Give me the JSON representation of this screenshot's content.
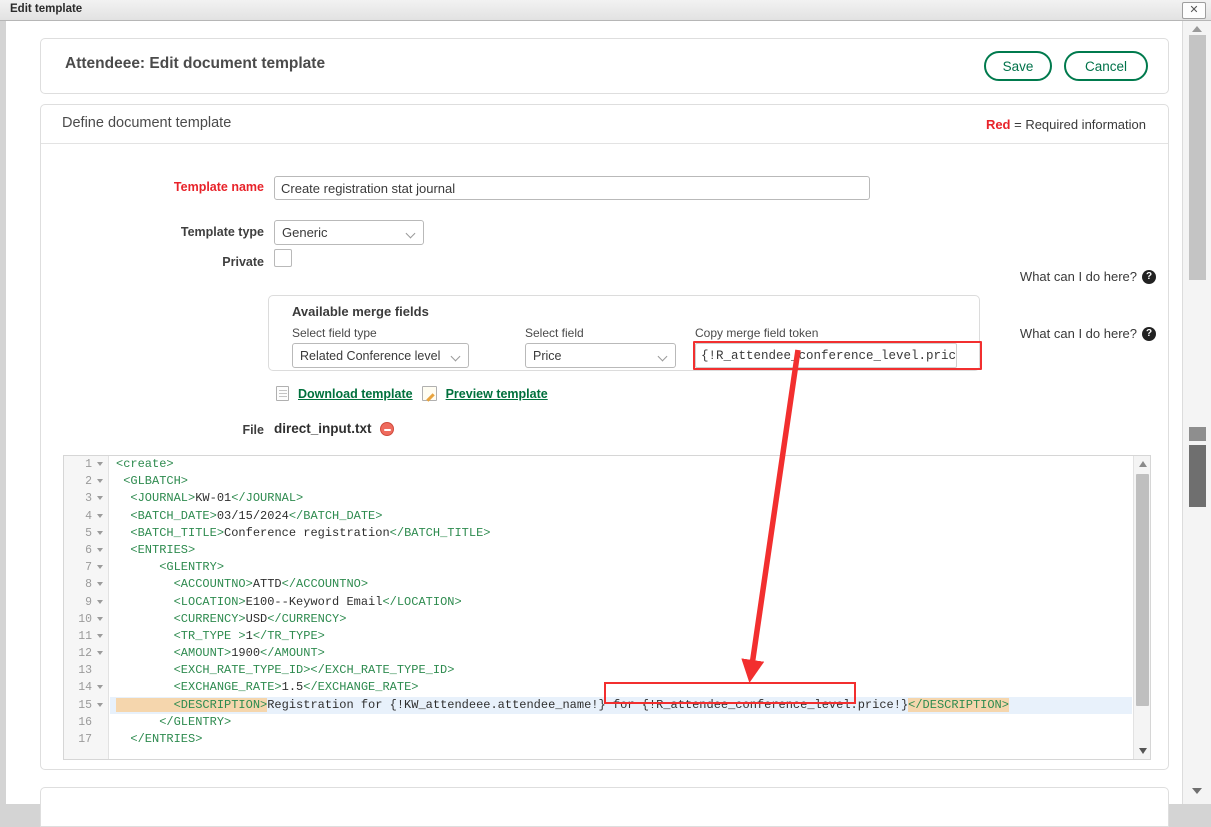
{
  "window": {
    "title": "Edit template",
    "close_label": "✕"
  },
  "header": {
    "page_title": "Attendeee: Edit document template",
    "save_label": "Save",
    "cancel_label": "Cancel"
  },
  "section": {
    "title": "Define document template",
    "required_red": "Red",
    "required_rest": " = Required information"
  },
  "form": {
    "template_name_label": "Template name",
    "template_name_value": "Create registration stat journal",
    "template_name_placeholder": "",
    "template_type_label": "Template type",
    "template_type_value": "Generic",
    "private_label": "Private",
    "file_label": "File",
    "file_name": "direct_input.txt"
  },
  "help": {
    "label": "What can I do here?",
    "icon": "question-circle-icon"
  },
  "merge_fields": {
    "panel_title": "Available merge fields",
    "field_type_label": "Select field type",
    "field_type_value": "Related Conference level",
    "field_label": "Select field",
    "field_value": "Price",
    "token_label": "Copy merge field token",
    "token_value": "{!R_attendee_conference_level.price!}"
  },
  "template_actions": {
    "download_label": "Download template",
    "preview_label": "Preview template",
    "download_icon": "document-icon",
    "preview_icon": "pencil-document-icon"
  },
  "editor": {
    "lines": [
      {
        "n": "1",
        "fold": true,
        "active": false,
        "segs": [
          {
            "t": "tag",
            "v": "<create>"
          }
        ]
      },
      {
        "n": "2",
        "fold": true,
        "active": false,
        "segs": [
          {
            "t": "tag",
            "v": " <GLBATCH>"
          }
        ]
      },
      {
        "n": "3",
        "fold": true,
        "active": false,
        "segs": [
          {
            "t": "tag",
            "v": "  <JOURNAL>"
          },
          {
            "t": "txt",
            "v": "KW-01"
          },
          {
            "t": "tag",
            "v": "</JOURNAL>"
          }
        ]
      },
      {
        "n": "4",
        "fold": true,
        "active": false,
        "segs": [
          {
            "t": "tag",
            "v": "  <BATCH_DATE>"
          },
          {
            "t": "txt",
            "v": "03/15/2024"
          },
          {
            "t": "tag",
            "v": "</BATCH_DATE>"
          }
        ]
      },
      {
        "n": "5",
        "fold": true,
        "active": false,
        "segs": [
          {
            "t": "tag",
            "v": "  <BATCH_TITLE>"
          },
          {
            "t": "txt",
            "v": "Conference registration"
          },
          {
            "t": "tag",
            "v": "</BATCH_TITLE>"
          }
        ]
      },
      {
        "n": "6",
        "fold": true,
        "active": false,
        "segs": [
          {
            "t": "tag",
            "v": "  <ENTRIES>"
          }
        ]
      },
      {
        "n": "7",
        "fold": true,
        "active": false,
        "segs": [
          {
            "t": "tag",
            "v": "      <GLENTRY>"
          }
        ]
      },
      {
        "n": "8",
        "fold": true,
        "active": false,
        "segs": [
          {
            "t": "tag",
            "v": "        <ACCOUNTNO>"
          },
          {
            "t": "txt",
            "v": "ATTD"
          },
          {
            "t": "tag",
            "v": "</ACCOUNTNO>"
          }
        ]
      },
      {
        "n": "9",
        "fold": true,
        "active": false,
        "segs": [
          {
            "t": "tag",
            "v": "        <LOCATION>"
          },
          {
            "t": "txt",
            "v": "E100--Keyword Email"
          },
          {
            "t": "tag",
            "v": "</LOCATION>"
          }
        ]
      },
      {
        "n": "10",
        "fold": true,
        "active": false,
        "segs": [
          {
            "t": "tag",
            "v": "        <CURRENCY>"
          },
          {
            "t": "txt",
            "v": "USD"
          },
          {
            "t": "tag",
            "v": "</CURRENCY>"
          }
        ]
      },
      {
        "n": "11",
        "fold": true,
        "active": false,
        "segs": [
          {
            "t": "tag",
            "v": "        <TR_TYPE >"
          },
          {
            "t": "txt",
            "v": "1"
          },
          {
            "t": "tag",
            "v": "</TR_TYPE>"
          }
        ]
      },
      {
        "n": "12",
        "fold": true,
        "active": false,
        "segs": [
          {
            "t": "tag",
            "v": "        <AMOUNT>"
          },
          {
            "t": "txt",
            "v": "1900"
          },
          {
            "t": "tag",
            "v": "</AMOUNT>"
          }
        ]
      },
      {
        "n": "13",
        "fold": false,
        "active": false,
        "segs": [
          {
            "t": "tag",
            "v": "        <EXCH_RATE_TYPE_ID></EXCH_RATE_TYPE_ID>"
          }
        ]
      },
      {
        "n": "14",
        "fold": true,
        "active": false,
        "segs": [
          {
            "t": "tag",
            "v": "        <EXCHANGE_RATE>"
          },
          {
            "t": "txt",
            "v": "1.5"
          },
          {
            "t": "tag",
            "v": "</EXCHANGE_RATE>"
          }
        ]
      },
      {
        "n": "15",
        "fold": true,
        "active": true,
        "segs": [
          {
            "t": "tag hl",
            "v": "        <DESCRIPTION>"
          },
          {
            "t": "txt",
            "v": "Registration for {!KW_attendeee.attendee_name!} for {!R_attendee_conference_level.price!}"
          },
          {
            "t": "tag hl",
            "v": "</DESCRIPTION>"
          }
        ]
      },
      {
        "n": "16",
        "fold": false,
        "active": false,
        "segs": [
          {
            "t": "tag",
            "v": "      </GLENTRY>"
          }
        ]
      },
      {
        "n": "17",
        "fold": false,
        "active": false,
        "segs": [
          {
            "t": "tag",
            "v": "  </ENTRIES>"
          }
        ]
      }
    ]
  },
  "colors": {
    "accent_green": "#00703c",
    "required_red": "#e8232a",
    "annotation_red": "#f22f2f",
    "tag_green": "#2e8b4f",
    "active_line": "#e8f1fb",
    "token_highlight": "#f5d6ad"
  }
}
